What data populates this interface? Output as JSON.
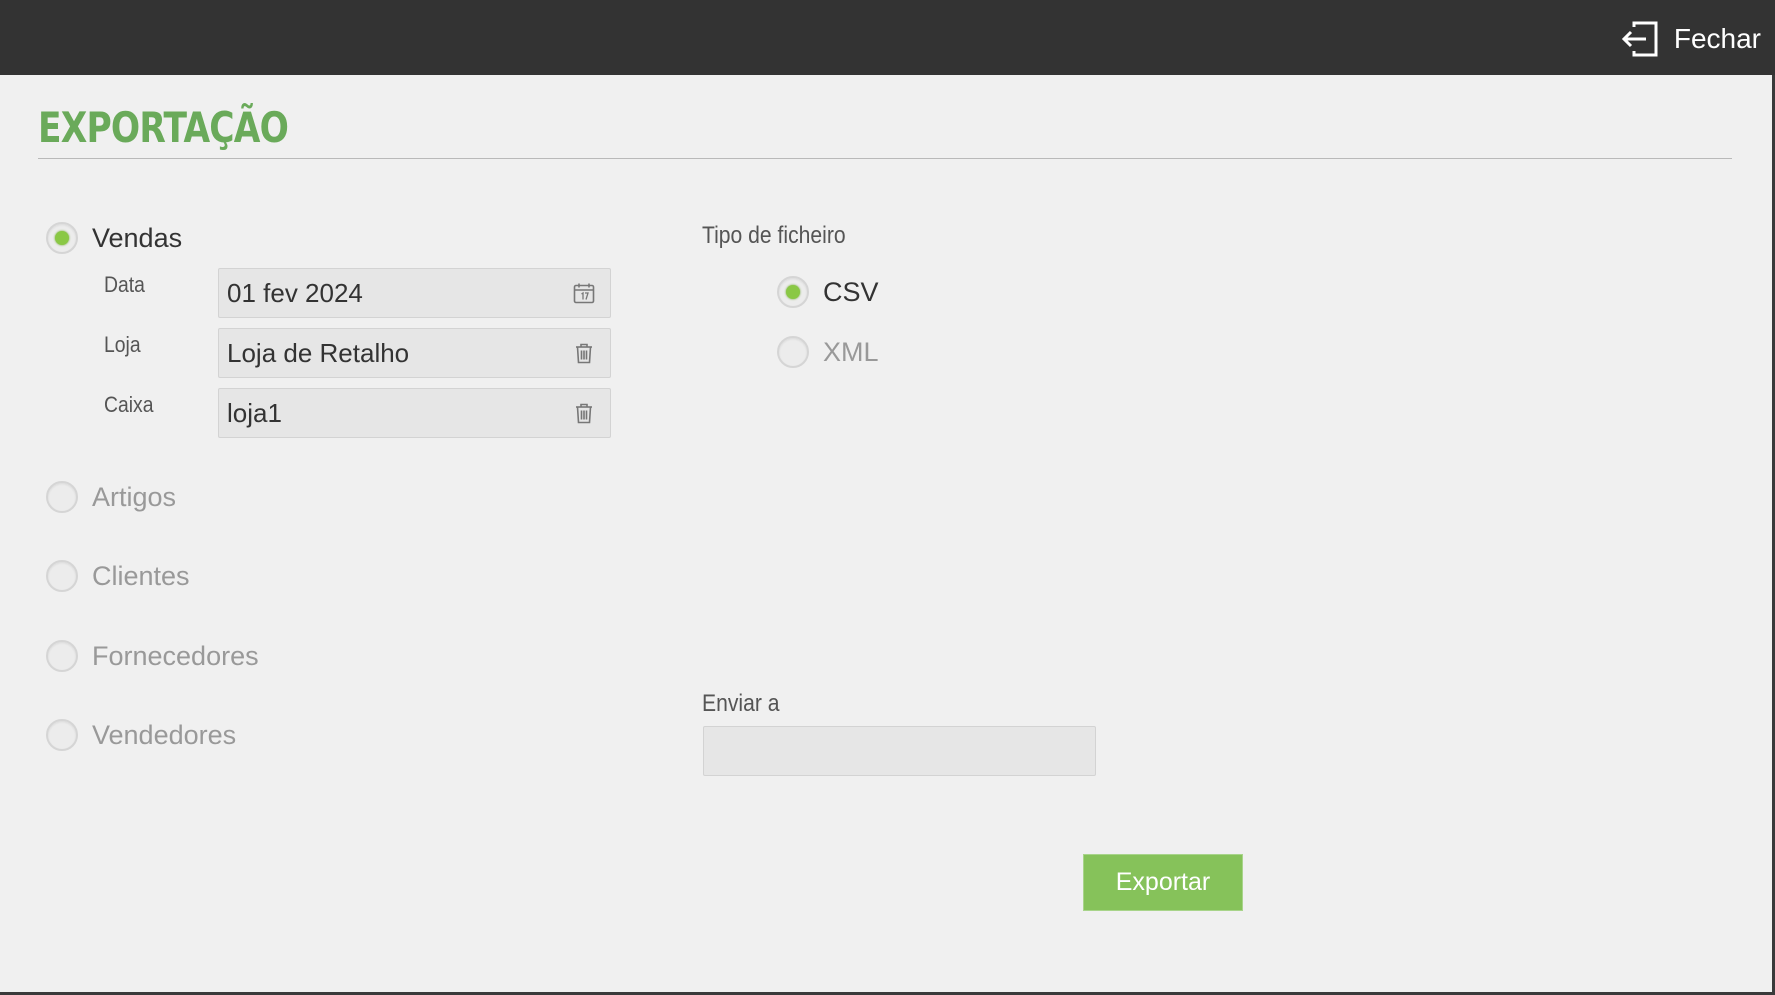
{
  "header": {
    "close_label": "Fechar",
    "close_icon": "exit-icon"
  },
  "page": {
    "title": "Exportação"
  },
  "export_types": [
    {
      "label": "Vendas",
      "checked": true
    },
    {
      "label": "Artigos",
      "checked": false
    },
    {
      "label": "Clientes",
      "checked": false
    },
    {
      "label": "Fornecedores",
      "checked": false
    },
    {
      "label": "Vendedores",
      "checked": false
    }
  ],
  "sales_filters": {
    "date": {
      "label": "Data",
      "value": "01 fev 2024",
      "icon": "calendar-icon"
    },
    "store": {
      "label": "Loja",
      "value": "Loja de Retalho",
      "icon": "trash-icon"
    },
    "register": {
      "label": "Caixa",
      "value": "loja1",
      "icon": "trash-icon"
    }
  },
  "file_type": {
    "label": "Tipo de ficheiro",
    "options": [
      {
        "label": "CSV",
        "checked": true
      },
      {
        "label": "XML",
        "checked": false
      }
    ]
  },
  "send_to": {
    "label": "Enviar a",
    "value": "",
    "placeholder": ""
  },
  "export_button": {
    "label": "Exportar"
  },
  "colors": {
    "accent_green": "#6aaa5a",
    "button_green": "#86c25a",
    "radio_dot": "#8ac845",
    "topbar": "#333333",
    "background": "#f0f0f0"
  }
}
